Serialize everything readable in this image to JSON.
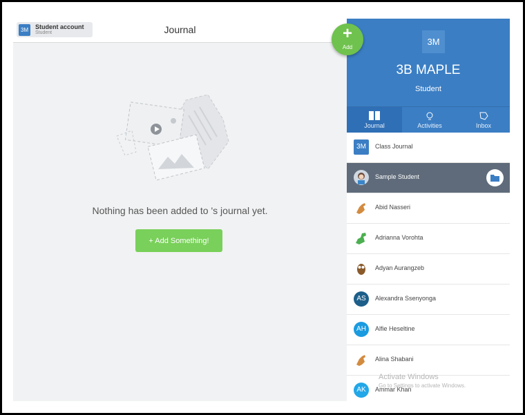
{
  "header": {
    "account_badge": "3M",
    "account_title": "Student account",
    "account_role": "Student",
    "page_title": "Journal"
  },
  "main": {
    "empty_message": "Nothing has been added to 's journal yet.",
    "add_button": "+ Add Something!"
  },
  "fab": {
    "plus": "+",
    "label": "Add"
  },
  "class_panel": {
    "logo": "3M",
    "class_name": "3B MAPLE",
    "role": "Student",
    "tabs": [
      {
        "label": "Journal",
        "icon": "book-icon",
        "active": true
      },
      {
        "label": "Activities",
        "icon": "lightbulb-icon",
        "active": false
      },
      {
        "label": "Inbox",
        "icon": "chat-bubble-icon",
        "active": false
      }
    ]
  },
  "list": [
    {
      "name": "Class Journal",
      "avatar_text": "3M",
      "avatar": "class-badge",
      "color": "#3b7ec4"
    },
    {
      "name": "Sample Student",
      "avatar_text": "",
      "avatar": "student-avatar-icon",
      "color": "#cfd8e3",
      "selected": true
    },
    {
      "name": "Abid Nasseri",
      "avatar_text": "",
      "avatar": "kangaroo-icon",
      "color": "#d38b3f"
    },
    {
      "name": "Adrianna Vorohta",
      "avatar_text": "",
      "avatar": "dinosaur-icon",
      "color": "#4caf50"
    },
    {
      "name": "Adyan Aurangzeb",
      "avatar_text": "",
      "avatar": "owl-icon",
      "color": "#8a5a2b"
    },
    {
      "name": "Alexandra Ssenyonga",
      "avatar_text": "AS",
      "avatar": "initials",
      "color": "#1d5f8a"
    },
    {
      "name": "Alfie Heseltine",
      "avatar_text": "AH",
      "avatar": "initials",
      "color": "#1a9be0"
    },
    {
      "name": "Alina Shabani",
      "avatar_text": "",
      "avatar": "kangaroo-icon",
      "color": "#d38b3f"
    },
    {
      "name": "Ammar Khan",
      "avatar_text": "AK",
      "avatar": "initials",
      "color": "#22a7e8"
    }
  ],
  "watermark": {
    "line1": "Activate Windows",
    "line2": "Go to Settings to activate Windows."
  }
}
